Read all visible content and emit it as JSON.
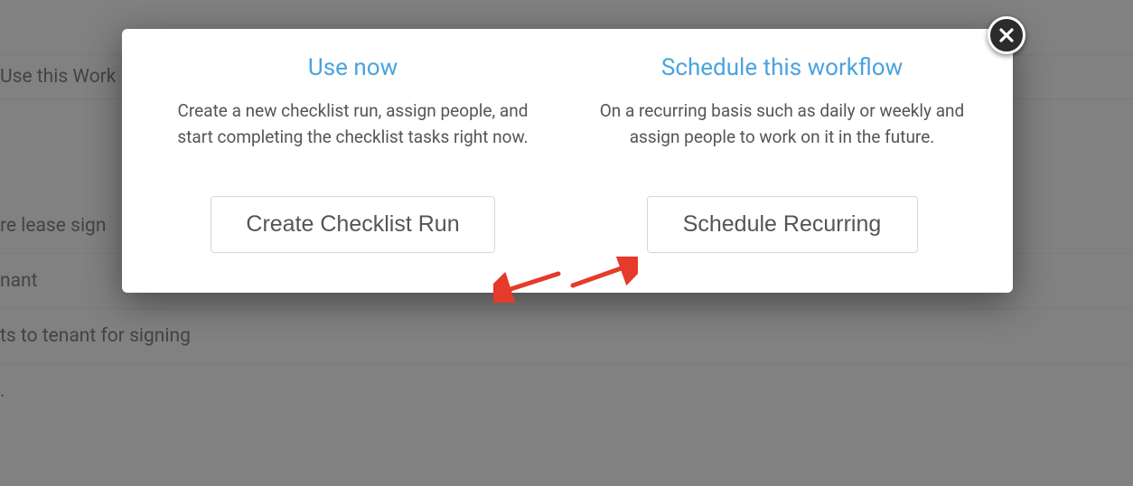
{
  "background": {
    "top_link": "Use this Work",
    "rows": [
      "re lease sign",
      "nant",
      "ts to tenant for signing",
      "."
    ]
  },
  "modal": {
    "left": {
      "title": "Use now",
      "description": "Create a new checklist run, assign people, and start completing the checklist tasks right now.",
      "button": "Create Checklist Run"
    },
    "right": {
      "title": "Schedule this workflow",
      "description": "On a recurring basis such as daily or weekly and assign people to work on it in the future.",
      "button": "Schedule Recurring"
    }
  },
  "annotations": {
    "arrow_color": "#e63a2a"
  }
}
